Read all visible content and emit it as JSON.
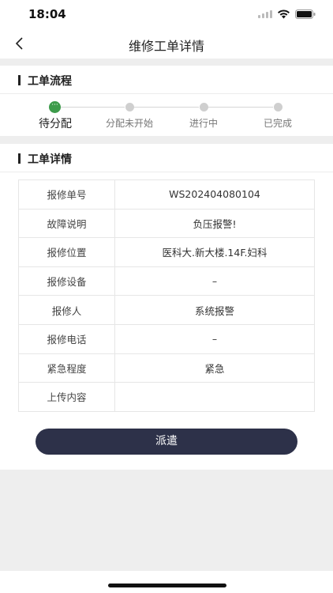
{
  "status_bar": {
    "time": "18:04"
  },
  "nav": {
    "title": "维修工单详情"
  },
  "workflow": {
    "title": "工单流程",
    "steps": [
      {
        "label": "待分配",
        "active": true
      },
      {
        "label": "分配未开始",
        "active": false
      },
      {
        "label": "进行中",
        "active": false
      },
      {
        "label": "已完成",
        "active": false
      }
    ],
    "active_glyph": "···"
  },
  "details": {
    "title": "工单详情",
    "rows": [
      {
        "key": "报修单号",
        "value": "WS202404080104"
      },
      {
        "key": "故障说明",
        "value": "负压报警!"
      },
      {
        "key": "报修位置",
        "value": "医科大.新大楼.14F.妇科"
      },
      {
        "key": "报修设备",
        "value": "–"
      },
      {
        "key": "报修人",
        "value": "系统报警"
      },
      {
        "key": "报修电话",
        "value": "–"
      },
      {
        "key": "紧急程度",
        "value": "紧急"
      },
      {
        "key": "上传内容",
        "value": ""
      }
    ]
  },
  "actions": {
    "dispatch_label": "派遣"
  },
  "colors": {
    "accent": "#2d3149",
    "step_active": "#3d9b4b",
    "background_band": "#eeeeee"
  }
}
